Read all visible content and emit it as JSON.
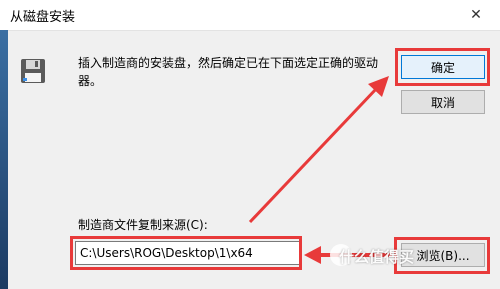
{
  "window": {
    "title": "从磁盘安装",
    "close_glyph": "✕"
  },
  "icons": {
    "disk": "floppy-disk-icon",
    "close": "close-icon"
  },
  "message": "插入制造商的安装盘，然后确定已在下面选定正确的驱动器。",
  "buttons": {
    "ok": "确定",
    "cancel": "取消",
    "browse": "浏览(B)..."
  },
  "source": {
    "label": "制造商文件复制来源(C):",
    "path": "C:\\Users\\ROG\\Desktop\\1\\x64"
  },
  "watermark": "什么值得买",
  "colors": {
    "annotation_red": "#e83a3a",
    "accent": "#0078d7"
  }
}
